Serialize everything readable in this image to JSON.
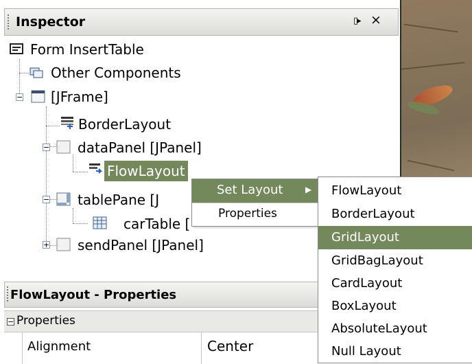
{
  "inspector": {
    "title": "Inspector",
    "dock_icon": "dock-icon",
    "close_icon": "close-icon",
    "dock_glyph": "▯▸",
    "close_glyph": "×",
    "tree": [
      {
        "label": "Form InsertTable",
        "icon": "form-icon"
      },
      {
        "label": "Other Components",
        "icon": "components-icon"
      },
      {
        "label": "[JFrame]",
        "icon": "frame-icon",
        "expander": "−"
      },
      {
        "label": "BorderLayout",
        "icon": "border-layout-icon"
      },
      {
        "label": "dataPanel [JPanel]",
        "icon": "panel-icon",
        "expander": "−"
      },
      {
        "label": "FlowLayout",
        "icon": "flow-layout-icon",
        "selected": true
      },
      {
        "label": "tablePane [J",
        "icon": "scroll-pane-icon",
        "expander": "−"
      },
      {
        "label": "carTable [",
        "icon": "table-icon"
      },
      {
        "label": "sendPanel [JPanel]",
        "icon": "panel-icon",
        "expander": "+"
      }
    ]
  },
  "properties_panel": {
    "title": "FlowLayout - Properties",
    "section": "Properties",
    "section_expander": "−",
    "rows": [
      {
        "name": "Alignment",
        "value": "Center"
      }
    ]
  },
  "context_menu": {
    "items": [
      {
        "label": "Set Layout",
        "highlighted": true,
        "submenu_arrow": "▶"
      },
      {
        "label": "Properties"
      }
    ]
  },
  "layout_submenu": {
    "items": [
      {
        "label": "FlowLayout"
      },
      {
        "label": "BorderLayout"
      },
      {
        "label": "GridLayout",
        "highlighted": true
      },
      {
        "label": "GridBagLayout"
      },
      {
        "label": "CardLayout"
      },
      {
        "label": "BoxLayout"
      },
      {
        "label": "AbsoluteLayout"
      },
      {
        "label": "Null Layout"
      }
    ]
  },
  "colors": {
    "highlight": "#73895c",
    "header_bg": "#e6e6e2",
    "window_border": "#2b2b2b"
  }
}
